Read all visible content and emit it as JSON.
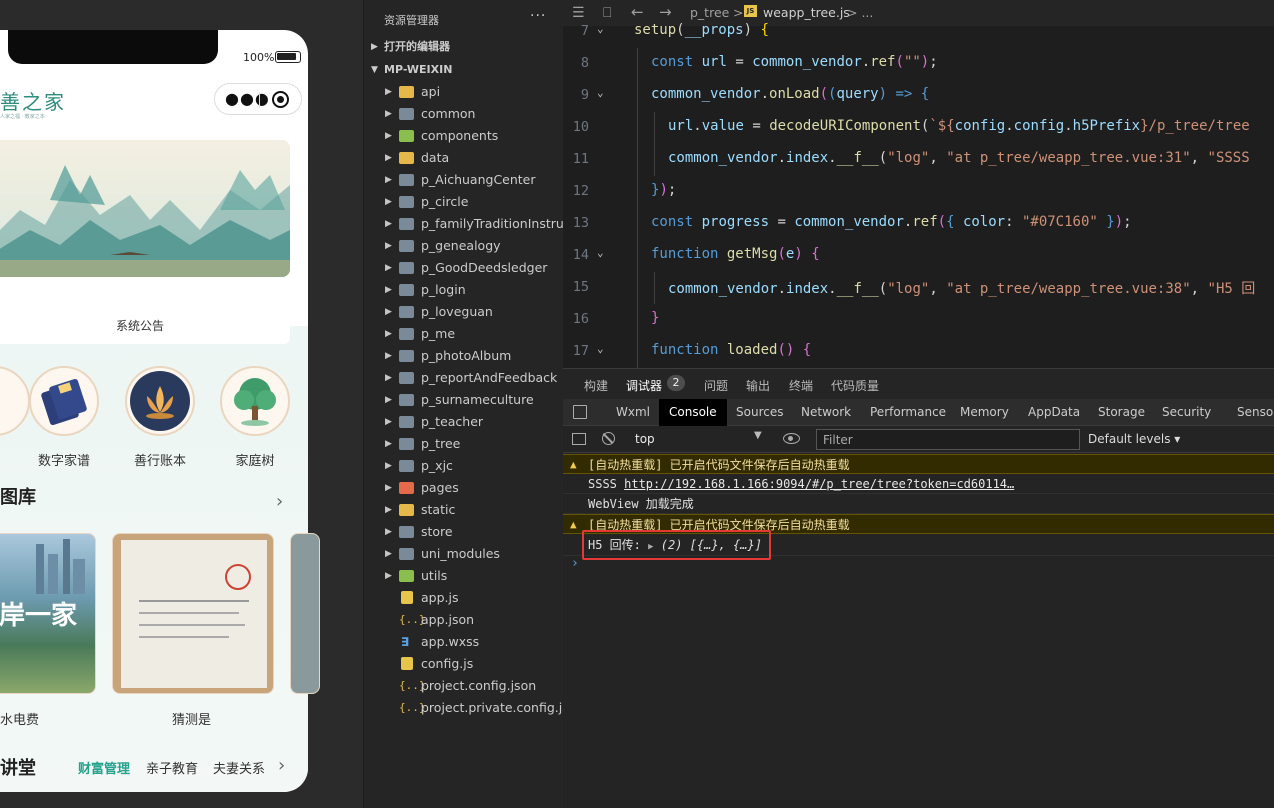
{
  "simulator": {
    "battery": "100%",
    "brand_title": "善之家",
    "brand_subtitle": "人家之福 · 教家之本",
    "notice": "系统公告",
    "feature_icons": [
      {
        "label": "数字家谱",
        "badge": "家谱"
      },
      {
        "label": "善行账本"
      },
      {
        "label": "家庭树"
      }
    ],
    "album_section_title": "图库",
    "album_items": [
      {
        "label": "水电费",
        "overlay": "岸一家"
      },
      {
        "label": "猜测是"
      }
    ],
    "lecture_section_title": "讲堂",
    "categories": [
      "财富管理",
      "亲子教育",
      "夫妻关系"
    ]
  },
  "explorer": {
    "title": "资源管理器",
    "more": "···",
    "open_editors": "打开的编辑器",
    "project": "MP-WEIXIN",
    "folders": [
      {
        "name": "api",
        "color": "yellow"
      },
      {
        "name": "common",
        "color": "plain"
      },
      {
        "name": "components",
        "color": "green"
      },
      {
        "name": "data",
        "color": "yellow"
      },
      {
        "name": "p_AichuangCenter",
        "color": "plain"
      },
      {
        "name": "p_circle",
        "color": "plain"
      },
      {
        "name": "p_familyTraditionInstru...",
        "color": "plain"
      },
      {
        "name": "p_genealogy",
        "color": "plain"
      },
      {
        "name": "p_GoodDeedsledger",
        "color": "plain"
      },
      {
        "name": "p_login",
        "color": "plain"
      },
      {
        "name": "p_loveguan",
        "color": "plain"
      },
      {
        "name": "p_me",
        "color": "plain"
      },
      {
        "name": "p_photoAlbum",
        "color": "plain"
      },
      {
        "name": "p_reportAndFeedback",
        "color": "plain"
      },
      {
        "name": "p_surnameculture",
        "color": "plain"
      },
      {
        "name": "p_teacher",
        "color": "plain"
      },
      {
        "name": "p_tree",
        "color": "plain"
      },
      {
        "name": "p_xjc",
        "color": "plain"
      },
      {
        "name": "pages",
        "color": "orange"
      },
      {
        "name": "static",
        "color": "yellow"
      },
      {
        "name": "store",
        "color": "plain"
      },
      {
        "name": "uni_modules",
        "color": "plain"
      },
      {
        "name": "utils",
        "color": "green"
      }
    ],
    "files": [
      {
        "name": "app.js",
        "type": "js",
        "glyph": ""
      },
      {
        "name": "app.json",
        "type": "json",
        "glyph": "{..}"
      },
      {
        "name": "app.wxss",
        "type": "css",
        "glyph": "∃"
      },
      {
        "name": "config.js",
        "type": "js",
        "glyph": ""
      },
      {
        "name": "project.config.json",
        "type": "json",
        "glyph": "{..}"
      },
      {
        "name": "project.private.config.js...",
        "type": "json",
        "glyph": "{..}"
      }
    ]
  },
  "editor": {
    "breadcrumb_folder": "p_tree",
    "breadcrumb_file": "weapp_tree.js",
    "breadcrumb_sep": ">",
    "breadcrumb_more": "> ...",
    "js_badge": "JS",
    "lines": [
      {
        "n": "7",
        "fold": true,
        "indent": 0
      },
      {
        "n": "8",
        "fold": false,
        "indent": 1
      },
      {
        "n": "9",
        "fold": true,
        "indent": 1
      },
      {
        "n": "10",
        "fold": false,
        "indent": 2
      },
      {
        "n": "11",
        "fold": false,
        "indent": 2
      },
      {
        "n": "12",
        "fold": false,
        "indent": 1
      },
      {
        "n": "13",
        "fold": false,
        "indent": 1
      },
      {
        "n": "14",
        "fold": true,
        "indent": 1
      },
      {
        "n": "15",
        "fold": false,
        "indent": 2
      },
      {
        "n": "16",
        "fold": false,
        "indent": 1
      },
      {
        "n": "17",
        "fold": true,
        "indent": 1
      }
    ]
  },
  "panel": {
    "tabs": [
      {
        "label": "构建"
      },
      {
        "label": "调试器",
        "badge": "2"
      },
      {
        "label": "问题"
      },
      {
        "label": "输出"
      },
      {
        "label": "终端"
      },
      {
        "label": "代码质量"
      }
    ],
    "devtools_tabs": [
      "Wxml",
      "Console",
      "Sources",
      "Network",
      "Performance",
      "Memory",
      "AppData",
      "Storage",
      "Security",
      "Sensor"
    ],
    "context": "top",
    "filter_placeholder": "Filter",
    "levels": "Default levels ▾",
    "console": {
      "warn1": "[自动热重载] 已开启代码文件保存后自动热重载",
      "log1_prefix": "SSSS ",
      "log1_link": "http://192.168.1.166:9094/#/p_tree/tree?token=cd60114…",
      "log2": "WebView 加载完成",
      "warn2": "[自动热重载] 已开启代码文件保存后自动热重载",
      "log3_prefix": "H5 回传: ",
      "log3_value": "(2) [{…}, {…}]",
      "prompt": "›"
    }
  }
}
